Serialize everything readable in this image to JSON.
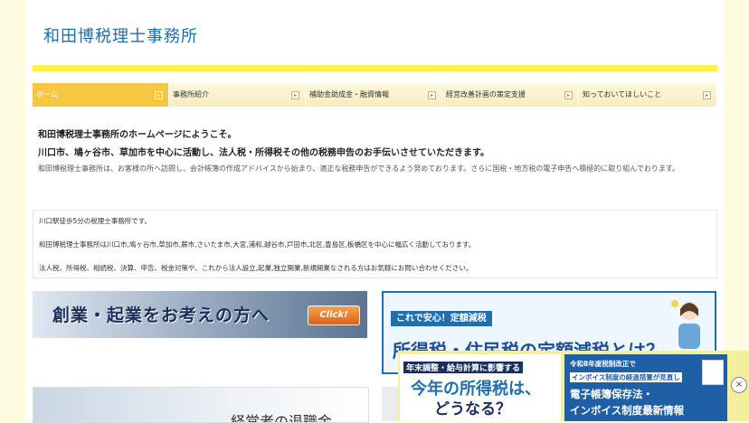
{
  "header": {
    "site_title": "和田博税理士事務所"
  },
  "nav": {
    "items": [
      {
        "label": "ホーム",
        "active": true
      },
      {
        "label": "事務所紹介",
        "active": false
      },
      {
        "label": "補助金助成金・融資情報",
        "active": false
      },
      {
        "label": "経営改善計画の策定支援",
        "active": false
      },
      {
        "label": "知っておいてほしいこと",
        "active": false
      }
    ],
    "arrow_icon": "triangle-right-icon"
  },
  "intro": {
    "welcome": "和田博税理士事務所のホームページにようこそ。",
    "lead": "川口市、鳩ヶ谷市、草加市を中心に活動し、法人税・所得税その他の税務申告のお手伝いさせていただきます。",
    "description": "和田博税理士事務所は、お客様の所へ訪問し、会計帳簿の作成アドバイスから始まり、適正な税務申告ができるよう努めております。さらに国税・地方税の電子申告へ積極的に取り組んでおります。"
  },
  "info_box": {
    "line1": "川口駅徒歩5分の税理士事務所です。",
    "line2": "和田博税理士事務所は川口市,鳩ヶ谷市,草加市,蕨市,さいたま市,大宮,浦和,越谷市,戸田市,北区,豊島区,板橋区を中心に幅広く活動しております。",
    "line3": "法人税、所得税、相続税、決算、申告、税金対策や、これから法人設立,起業,独立開業,新規開業なされる方はお気軽にお問い合わせください。"
  },
  "banners": {
    "startup": {
      "text": "創業・起業をお考えの方へ",
      "button": "Click!"
    },
    "tax_reduction": {
      "tag": "これで安心！定額減税",
      "headline": "所得税・住民税の定額減税とは？"
    },
    "retirement": {
      "text": "経営者の退職金"
    }
  },
  "popup": {
    "ad1": {
      "tag": "年末調整・給与計算に影響する",
      "headline1": "今年の所得税は、",
      "headline2": "どうなる？"
    },
    "ad2": {
      "line1": "令和8年度税制改正で",
      "line2": "インボイス制度の経過措置が見直し",
      "headline1": "電子帳簿保存法・",
      "headline2": "インボイス制度最新情報"
    },
    "close_label": "×"
  },
  "colors": {
    "accent_blue": "#1e6fb0",
    "nav_active": "#f6c644",
    "yellow_bar": "#fff04a",
    "bg": "#fffbe0"
  }
}
